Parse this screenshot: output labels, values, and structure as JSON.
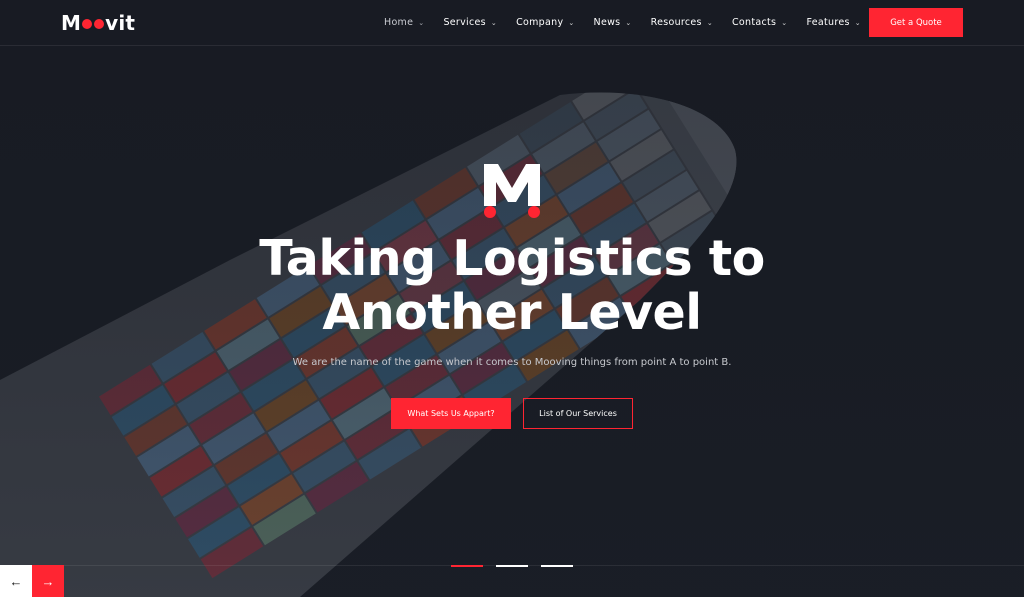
{
  "brand": {
    "name_prefix": "M",
    "name_suffix": "vit",
    "accent_color": "#ff2532"
  },
  "nav": {
    "items": [
      {
        "label": "Home",
        "active": true
      },
      {
        "label": "Services"
      },
      {
        "label": "Company"
      },
      {
        "label": "News"
      },
      {
        "label": "Resources"
      },
      {
        "label": "Contacts"
      },
      {
        "label": "Features"
      }
    ],
    "cta_label": "Get a Quote"
  },
  "hero": {
    "headline_line1": "Taking Logistics to",
    "headline_line2": "Another Level",
    "subtext": "We are the name of the game when it comes to Mooving things from point A to point B.",
    "primary_button": "What Sets Us Appart?",
    "secondary_button": "List of Our Services",
    "slides": [
      {
        "active": true
      },
      {
        "active": false
      },
      {
        "active": false
      }
    ]
  },
  "icons": {
    "prev": "arrow-left-icon",
    "next": "arrow-right-icon",
    "chevron": "chevron-down-icon"
  }
}
